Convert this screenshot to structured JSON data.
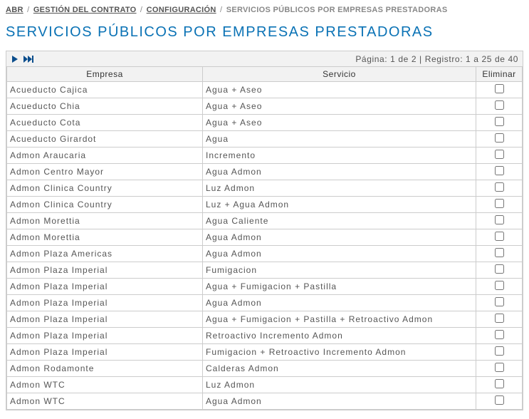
{
  "breadcrumb": {
    "abr": "ABR",
    "gestion": "GESTIÓN DEL CONTRATO",
    "config": "CONFIGURACIÓN",
    "current": "SERVICIOS PÚBLICOS POR EMPRESAS PRESTADORAS"
  },
  "title": "SERVICIOS PÚBLICOS POR EMPRESAS PRESTADORAS",
  "pager": {
    "info": "Página: 1 de 2  |  Registro: 1 a 25 de 40"
  },
  "columns": {
    "empresa": "Empresa",
    "servicio": "Servicio",
    "eliminar": "Eliminar"
  },
  "rows": [
    {
      "empresa": "Acueducto Cajica",
      "servicio": "Agua + Aseo"
    },
    {
      "empresa": "Acueducto Chia",
      "servicio": "Agua + Aseo"
    },
    {
      "empresa": "Acueducto Cota",
      "servicio": "Agua + Aseo"
    },
    {
      "empresa": "Acueducto Girardot",
      "servicio": "Agua"
    },
    {
      "empresa": "Admon Araucaria",
      "servicio": "Incremento"
    },
    {
      "empresa": "Admon Centro Mayor",
      "servicio": "Agua Admon"
    },
    {
      "empresa": "Admon Clinica Country",
      "servicio": "Luz Admon"
    },
    {
      "empresa": "Admon Clinica Country",
      "servicio": "Luz + Agua Admon"
    },
    {
      "empresa": "Admon Morettia",
      "servicio": "Agua Caliente"
    },
    {
      "empresa": "Admon Morettia",
      "servicio": "Agua Admon"
    },
    {
      "empresa": "Admon Plaza Americas",
      "servicio": "Agua Admon"
    },
    {
      "empresa": "Admon Plaza Imperial",
      "servicio": "Fumigacion"
    },
    {
      "empresa": "Admon Plaza Imperial",
      "servicio": "Agua + Fumigacion + Pastilla"
    },
    {
      "empresa": "Admon Plaza Imperial",
      "servicio": "Agua Admon"
    },
    {
      "empresa": "Admon Plaza Imperial",
      "servicio": "Agua + Fumigacion + Pastilla + Retroactivo Admon"
    },
    {
      "empresa": "Admon Plaza Imperial",
      "servicio": "Retroactivo Incremento Admon"
    },
    {
      "empresa": "Admon Plaza Imperial",
      "servicio": "Fumigacion + Retroactivo Incremento Admon"
    },
    {
      "empresa": "Admon Rodamonte",
      "servicio": "Calderas Admon"
    },
    {
      "empresa": "Admon WTC",
      "servicio": "Luz Admon"
    },
    {
      "empresa": "Admon WTC",
      "servicio": "Agua Admon"
    }
  ]
}
